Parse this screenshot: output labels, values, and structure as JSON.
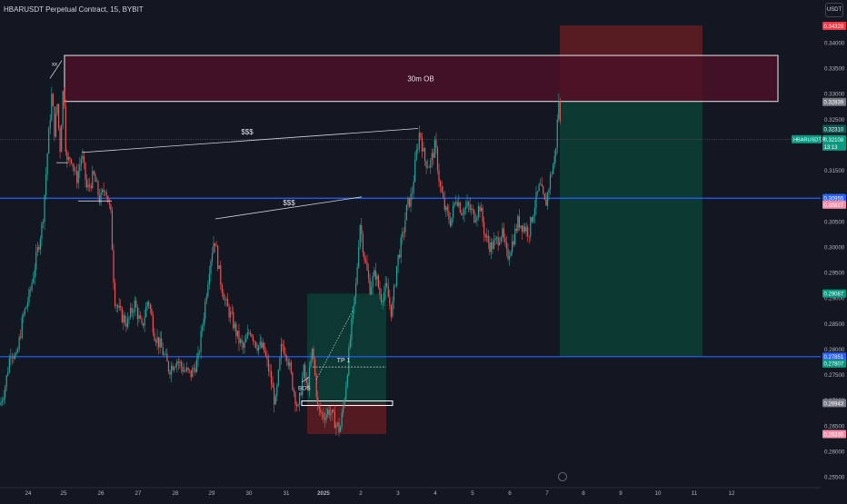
{
  "header": {
    "title": "HBARUSDT Perpetual Contract, 15, BYBIT",
    "currency": "USDT"
  },
  "colors": {
    "background": "#131722",
    "up_candle": "#26a69a",
    "down_candle": "#ef5350",
    "blue_level": "#2962ff",
    "ob_fill": "#4a1226",
    "target_fill": "#0d3b35",
    "stop_fill": "#5a1c22"
  },
  "chart_data": {
    "type": "candlestick",
    "symbol": "HBARUSDT",
    "interval": "15",
    "exchange": "BYBIT",
    "ylim": [
      0.2525,
      0.3475
    ],
    "y_ticks": [
      0.255,
      0.26,
      0.265,
      0.27,
      0.275,
      0.28,
      0.285,
      0.29,
      0.295,
      0.3,
      0.305,
      0.31,
      0.315,
      0.32,
      0.325,
      0.33,
      0.335,
      0.34
    ],
    "x_ticks": [
      "24",
      "25",
      "26",
      "27",
      "28",
      "29",
      "30",
      "31",
      "2025",
      "2",
      "3",
      "4",
      "5",
      "6",
      "7",
      "8",
      "9",
      "10",
      "11",
      "12"
    ],
    "approx_price_path": [
      [
        "24",
        0.269
      ],
      [
        "24",
        0.273
      ],
      [
        "24",
        0.278
      ],
      [
        "24",
        0.291
      ],
      [
        "24",
        0.305
      ],
      [
        "24",
        0.318
      ],
      [
        "25",
        0.333
      ],
      [
        "25",
        0.315
      ],
      [
        "25",
        0.3178
      ],
      [
        "25",
        0.314
      ],
      [
        "26",
        0.317
      ],
      [
        "26",
        0.309
      ],
      [
        "26",
        0.311
      ],
      [
        "26",
        0.288
      ],
      [
        "27",
        0.284
      ],
      [
        "27",
        0.289
      ],
      [
        "27",
        0.28
      ],
      [
        "28",
        0.276
      ],
      [
        "28",
        0.278
      ],
      [
        "28",
        0.286
      ],
      [
        "29",
        0.304
      ],
      [
        "29",
        0.293
      ],
      [
        "29",
        0.29
      ],
      [
        "30",
        0.279
      ],
      [
        "30",
        0.284
      ],
      [
        "30",
        0.281
      ],
      [
        "31",
        0.269
      ],
      [
        "31",
        0.282
      ],
      [
        "31",
        0.271
      ],
      [
        "2025",
        0.267
      ],
      [
        "2025",
        0.269
      ],
      [
        "2025",
        0.267
      ],
      [
        "2",
        0.282
      ],
      [
        "2",
        0.297
      ],
      [
        "2",
        0.293
      ],
      [
        "2",
        0.29
      ],
      [
        "3",
        0.299
      ],
      [
        "3",
        0.302
      ],
      [
        "3",
        0.315
      ],
      [
        "4",
        0.3225
      ],
      [
        "4",
        0.313
      ],
      [
        "4",
        0.31
      ],
      [
        "5",
        0.304
      ],
      [
        "5",
        0.301
      ],
      [
        "5",
        0.303
      ],
      [
        "6",
        0.298
      ],
      [
        "6",
        0.3025
      ],
      [
        "6",
        0.299
      ],
      [
        "7",
        0.309
      ],
      [
        "7",
        0.3185
      ],
      [
        "7",
        0.329
      ]
    ],
    "price_labels": [
      {
        "value": "0.34329",
        "kind": "stop"
      },
      {
        "value": "0.32839",
        "kind": "entry"
      },
      {
        "value": "0.32310",
        "kind": "current-high"
      },
      {
        "value": "0.32108",
        "kind": "last"
      },
      {
        "value": "13:13",
        "kind": "countdown"
      },
      {
        "value": "0.30955",
        "kind": "blue-level"
      },
      {
        "value": "0.30827",
        "kind": "pink"
      },
      {
        "value": "0.29087",
        "kind": "target"
      },
      {
        "value": "0.27851",
        "kind": "blue-level-2"
      },
      {
        "value": "0.27807",
        "kind": "target-2"
      },
      {
        "value": "0.26943",
        "kind": "grey"
      },
      {
        "value": "0.26335",
        "kind": "stop-2"
      }
    ],
    "symbol_tag": "HBARUSDT.P",
    "horizontal_levels": [
      0.30955,
      0.27851
    ],
    "order_block": {
      "label": "30m OB",
      "low": 0.3285,
      "high": 0.3375
    },
    "short_position": {
      "entry": 0.32839,
      "stop": 0.34329,
      "target": 0.27851
    },
    "long_position": {
      "entry": 0.2694,
      "stop": 0.26335,
      "target": 0.29087
    },
    "annotations": [
      {
        "text": "$$$",
        "kind": "liquidity-line-1"
      },
      {
        "text": "$$$",
        "kind": "liquidity-line-2"
      },
      {
        "text": "TP 1",
        "kind": "target-label"
      },
      {
        "text": "BOS",
        "kind": "structure-label"
      },
      {
        "text": "xx",
        "kind": "sweep-marker"
      }
    ]
  }
}
